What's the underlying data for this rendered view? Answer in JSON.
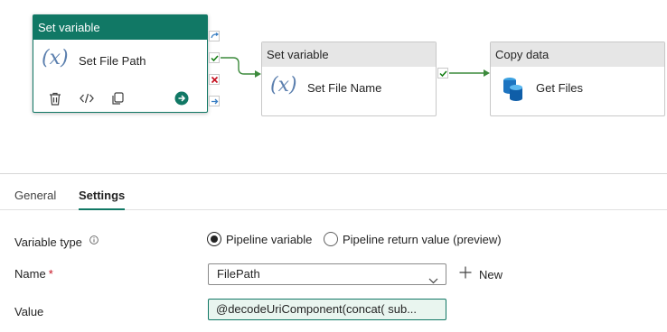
{
  "canvas": {
    "nodes": [
      {
        "header": "Set variable",
        "label": "Set File Path",
        "icon": "variable-icon",
        "selected": true
      },
      {
        "header": "Set variable",
        "label": "Set File Name",
        "icon": "variable-icon",
        "selected": false
      },
      {
        "header": "Copy data",
        "label": "Get Files",
        "icon": "copy-data-icon",
        "selected": false
      }
    ],
    "node_actions": [
      "delete-icon",
      "code-icon",
      "copy-icon",
      "run-icon"
    ],
    "ports": [
      "skip-port",
      "success-port",
      "failure-port",
      "completion-port"
    ],
    "colors": {
      "accent": "#117865",
      "success": "#107c10",
      "failure": "#c50f1f",
      "link": "#3c8a3c",
      "variable": "#5b7fae"
    }
  },
  "tabs": [
    {
      "label": "General",
      "active": false
    },
    {
      "label": "Settings",
      "active": true
    }
  ],
  "form": {
    "variable_type": {
      "label": "Variable type",
      "options": [
        {
          "label": "Pipeline variable",
          "checked": true
        },
        {
          "label": "Pipeline return value (preview)",
          "checked": false
        }
      ]
    },
    "name": {
      "label": "Name",
      "required_mark": "*",
      "value": "FilePath",
      "new_label": "New"
    },
    "value": {
      "label": "Value",
      "value": "@decodeUriComponent(concat( sub..."
    }
  }
}
